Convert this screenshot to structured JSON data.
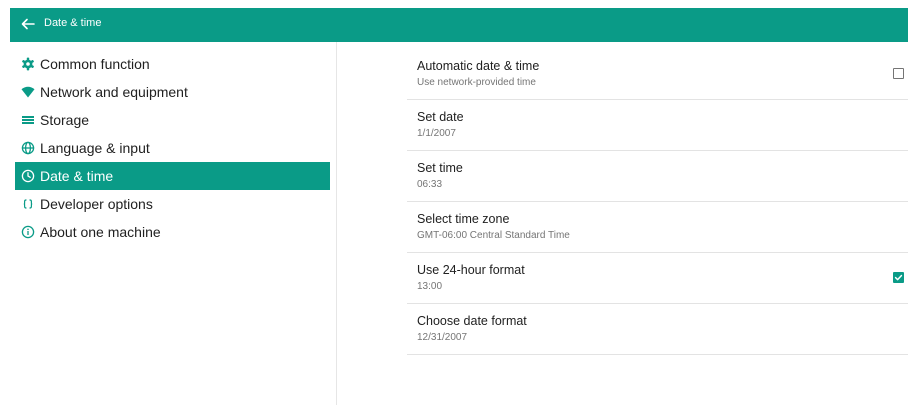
{
  "appbar": {
    "title": "Date & time",
    "back_icon": "arrow-left-icon"
  },
  "colors": {
    "accent": "#0a9b87"
  },
  "sidebar": {
    "items": [
      {
        "label": "Common function",
        "icon": "gear-icon",
        "active": false
      },
      {
        "label": "Network and equipment",
        "icon": "wifi-icon",
        "active": false
      },
      {
        "label": "Storage",
        "icon": "storage-icon",
        "active": false
      },
      {
        "label": "Language & input",
        "icon": "globe-icon",
        "active": false
      },
      {
        "label": "Date & time",
        "icon": "clock-icon",
        "active": true
      },
      {
        "label": "Developer options",
        "icon": "braces-icon",
        "active": false
      },
      {
        "label": "About one machine",
        "icon": "info-icon",
        "active": false
      }
    ]
  },
  "settings": [
    {
      "title": "Automatic date & time",
      "subtitle": "Use network-provided time",
      "checkbox": "unchecked"
    },
    {
      "title": "Set date",
      "subtitle": "1/1/2007"
    },
    {
      "title": "Set time",
      "subtitle": "06:33"
    },
    {
      "title": "Select time zone",
      "subtitle": "GMT-06:00 Central Standard Time"
    },
    {
      "title": "Use 24-hour format",
      "subtitle": "13:00",
      "checkbox": "checked"
    },
    {
      "title": "Choose date format",
      "subtitle": "12/31/2007"
    }
  ]
}
